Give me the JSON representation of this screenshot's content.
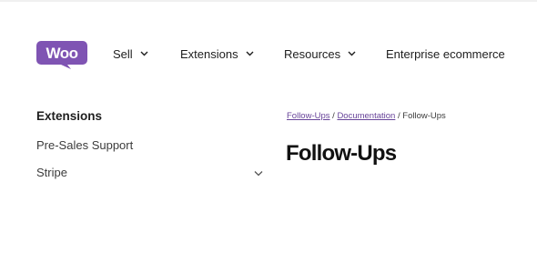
{
  "brand": {
    "logo_text": "Woo",
    "color": "#7f54b3"
  },
  "nav": {
    "items": [
      {
        "label": "Sell",
        "has_dropdown": true
      },
      {
        "label": "Extensions",
        "has_dropdown": true
      },
      {
        "label": "Resources",
        "has_dropdown": true
      },
      {
        "label": "Enterprise ecommerce",
        "has_dropdown": false
      }
    ]
  },
  "sidebar": {
    "heading": "Extensions",
    "items": [
      {
        "label": "Pre-Sales Support",
        "expandable": false
      },
      {
        "label": "Stripe",
        "expandable": true
      }
    ]
  },
  "breadcrumb": {
    "items": [
      {
        "label": "Follow-Ups",
        "link": true
      },
      {
        "label": "Documentation",
        "link": true
      },
      {
        "label": "Follow-Ups",
        "link": false
      }
    ],
    "separator": "/",
    "link_color": "#674399"
  },
  "main": {
    "title": "Follow-Ups"
  }
}
